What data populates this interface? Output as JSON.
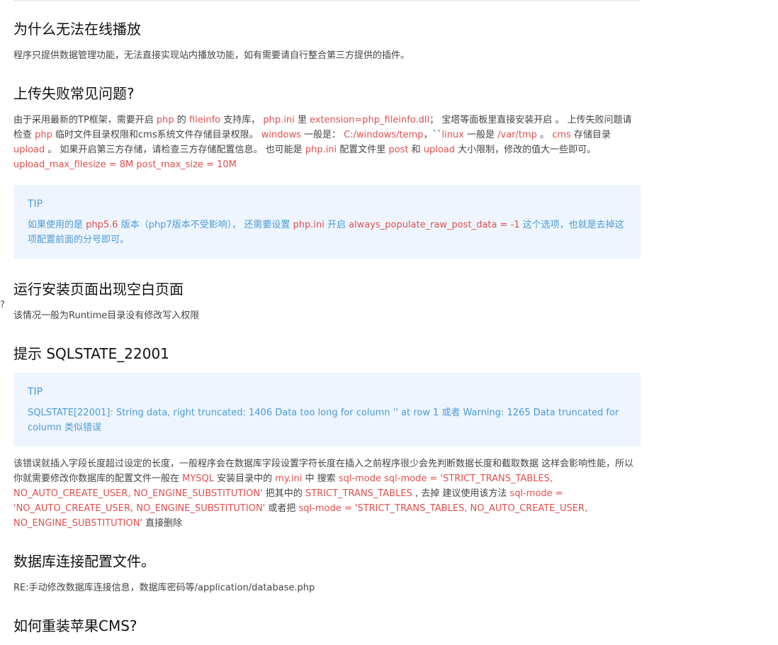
{
  "stray_mark": "?",
  "s1": {
    "title": "为什么无法在线播放",
    "body": "程序只提供数据管理功能，无法直接实现站内播放功能，如有需要请自行整合第三方提供的插件。"
  },
  "s2": {
    "title": "上传失败常见问题?",
    "t1": "由于采用最新的TP框架，需要开启 ",
    "c1": "php",
    "t2": " 的 ",
    "c2": "fileinfo",
    "t3": " 支持库， ",
    "c3": "php.ini",
    "t4": " 里 ",
    "c4": "extension=php_fileinfo.dll",
    "t5": "； 宝塔等面板里直接安装开启 。 上传失败问题请检查 ",
    "c5": "php",
    "t6": " 临时文件目录权限和cms系统文件存储目录权限。 ",
    "c6": "windows",
    "t7": " 一般是： ",
    "c7": "C:/windows/temp",
    "t8": "，``",
    "c8": "linux",
    "t9": " 一般是 ",
    "c9": "/var/tmp",
    "t10": " 。 ",
    "c10": "cms",
    "t11": " 存储目录 ",
    "c11": "upload",
    "t12": " 。 如果开启第三方存储，请检查三方存储配置信息。 也可能是 ",
    "c12": "php.ini",
    "t13": " 配置文件里 ",
    "c13": "post",
    "t14": " 和 ",
    "c14": "upload",
    "t15": " 大小限制，修改的值大一些即可。 ",
    "c15": "upload_max_filesize = 8M post_max_size = 10M",
    "tip": {
      "title": "TIP",
      "t1": "如果使用的是 ",
      "c1": "php5.6",
      "t2": " 版本（php7版本不受影响）， 还需要设置 ",
      "c2": "php.ini",
      "t3": " 开启 ",
      "c3": "always_populate_raw_post_data = -1",
      "t4": " 这个选项，也就是去掉这项配置前面的分号即可。"
    }
  },
  "s3": {
    "title": "运行安装页面出现空白页面",
    "body": "该情况一般为Runtime目录没有修改写入权限"
  },
  "s4": {
    "title": "提示 SQLSTATE_22001",
    "tip": {
      "title": "TIP",
      "body": "SQLSTATE[22001]: String data, right truncated: 1406 Data too long for column '' at row 1 或者 Warning: 1265 Data truncated for column 类似错误"
    },
    "t1": "该错误就插入字段长度超过设定的长度，一般程序会在数据库字段设置字符长度在插入之前程序很少会先判断数据长度和截取数据 这样会影响性能，所以你就需要修改你数据库的配置文件一般在 ",
    "c1": "MYSQL",
    "t2": " 安装目录中的 ",
    "c2": "my.ini",
    "t3": " 中 搜索 ",
    "c3": "sql-mode sql-mode = 'STRICT_TRANS_TABLES, NO_AUTO_CREATE_USER, NO_ENGINE_SUBSTITUTION'",
    "t4": " 把其中的 ",
    "c4": "STRICT_TRANS_TABLES",
    "t5": " , 去掉 建议使用该方法 ",
    "c5": "sql-mode = 'NO_AUTO_CREATE_USER, NO_ENGINE_SUBSTITUTION'",
    "t6": " 或者把 ",
    "c6": "sql-mode = 'STRICT_TRANS_TABLES, NO_AUTO_CREATE_USER, NO_ENGINE_SUBSTITUTION'",
    "t7": " 直接删除"
  },
  "s5": {
    "title": "数据库连接配置文件。",
    "body": "RE:手动修改数据库连接信息，数据库密码等/application/database.php"
  },
  "s6": {
    "title": "如何重装苹果CMS?"
  }
}
